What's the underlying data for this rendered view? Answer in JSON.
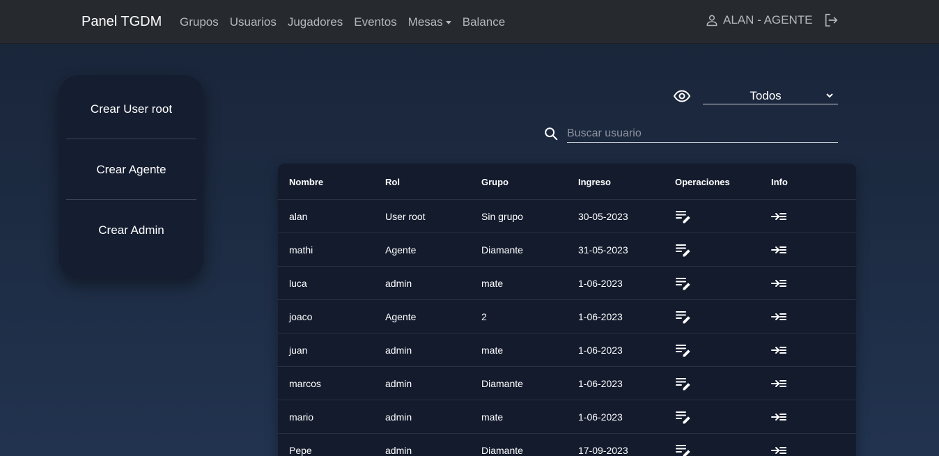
{
  "navbar": {
    "brand": "Panel TGDM",
    "links": [
      "Grupos",
      "Usuarios",
      "Jugadores",
      "Eventos",
      "Mesas",
      "Balance"
    ],
    "user": "ALAN - AGENTE"
  },
  "sidebar": {
    "items": [
      "Crear User root",
      "Crear Agente",
      "Crear Admin"
    ]
  },
  "filter": {
    "selected": "Todos"
  },
  "search": {
    "placeholder": "Buscar usuario",
    "value": ""
  },
  "table": {
    "headers": [
      "Nombre",
      "Rol",
      "Grupo",
      "Ingreso",
      "Operaciones",
      "Info"
    ],
    "rows": [
      {
        "nombre": "alan",
        "rol": "User root",
        "grupo": "Sin grupo",
        "ingreso": "30-05-2023"
      },
      {
        "nombre": "mathi",
        "rol": "Agente",
        "grupo": "Diamante",
        "ingreso": "31-05-2023"
      },
      {
        "nombre": "luca",
        "rol": "admin",
        "grupo": "mate",
        "ingreso": "1-06-2023"
      },
      {
        "nombre": "joaco",
        "rol": "Agente",
        "grupo": "2",
        "ingreso": "1-06-2023"
      },
      {
        "nombre": "juan",
        "rol": "admin",
        "grupo": "mate",
        "ingreso": "1-06-2023"
      },
      {
        "nombre": "marcos",
        "rol": "admin",
        "grupo": "Diamante",
        "ingreso": "1-06-2023"
      },
      {
        "nombre": "mario",
        "rol": "admin",
        "grupo": "mate",
        "ingreso": "1-06-2023"
      },
      {
        "nombre": "Pepe",
        "rol": "admin",
        "grupo": "Diamante",
        "ingreso": "17-09-2023"
      }
    ]
  },
  "icons": {
    "user": "person-icon",
    "logout": "logout-icon",
    "filter": "eye-icon",
    "search": "search-icon",
    "edit": "edit-list-icon",
    "info": "arrow-list-icon"
  },
  "colors": {
    "navbar": "#262a2f",
    "background": "#1e2d45",
    "card": "#131b2d",
    "muted_text": "#b4b8bd"
  }
}
